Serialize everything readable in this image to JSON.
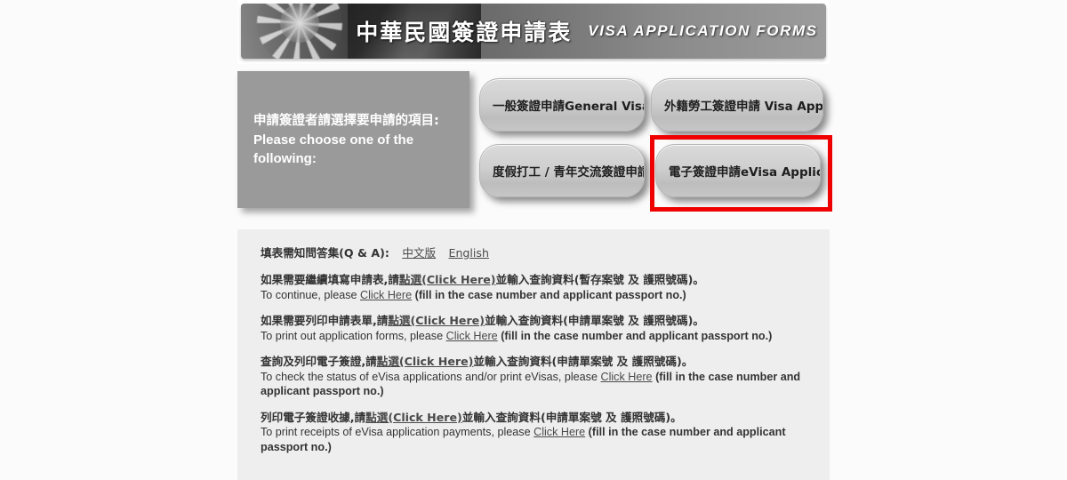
{
  "banner": {
    "title_cn": "中華民國簽證申請表",
    "title_en": "VISA APPLICATION FORMS",
    "art_name": "roc-flag-sun-emblem"
  },
  "chooser": {
    "prompt_cn": "申請簽證者請選擇要申請的項目:",
    "prompt_en_line1": "Please choose one of the",
    "prompt_en_line2": "following:",
    "buttons": [
      {
        "id": "general",
        "label": "一般簽證申請General Visa Ap"
      },
      {
        "id": "worker",
        "label": "外籍勞工簽證申請 Visa Applica"
      },
      {
        "id": "workhol",
        "label": "度假打工 / 青年交流簽證申請Wo"
      },
      {
        "id": "evisa",
        "label": "電子簽證申請eVisa Applicatio"
      }
    ],
    "highlight_color": "#ee0000",
    "highlighted_button": "evisa"
  },
  "instructions": {
    "qa_label": "填表需知問答集(Q & A):",
    "qa_link_cn": "中文版",
    "qa_link_en": "English",
    "paragraphs": [
      {
        "cn_before": "如果需要繼續填寫申請表,請",
        "cn_link": "點選(Click Here)",
        "cn_after": "並輸入查詢資料(暫存案號 及 護照號碼)。",
        "en_before": "To continue, please ",
        "en_link": "Click Here",
        "en_after": " (fill in the case number and applicant passport no.)"
      },
      {
        "cn_before": "如果需要列印申請表單,請",
        "cn_link": "點選(Click Here)",
        "cn_after": "並輸入查詢資料(申請單案號 及 護照號碼)。",
        "en_before": "To print out application forms, please ",
        "en_link": "Click Here",
        "en_after": " (fill in the case number and applicant passport no.)"
      },
      {
        "cn_before": "查詢及列印電子簽證,請",
        "cn_link": "點選(Click Here)",
        "cn_after": "並輸入查詢資料(申請單案號 及 護照號碼)。",
        "en_before": "To check the status of eVisa applications and/or print eVisas, please ",
        "en_link": "Click Here",
        "en_after": " (fill in the case number and applicant passport no.)"
      },
      {
        "cn_before": "列印電子簽證收據,請",
        "cn_link": "點選(Click Here)",
        "cn_after": "並輸入查詢資料(申請單案號 及 護照號碼)。",
        "en_before": "To print receipts of eVisa application payments, please ",
        "en_link": "Click Here",
        "en_after": " (fill in the case number and applicant passport no.)"
      }
    ]
  },
  "colors": {
    "page_bg": "#fbfbfb",
    "panel_gray": "#9a9a9a",
    "content_bg": "#eeeeee",
    "button_face": "#cfcfcf",
    "highlight_red": "#ee0000"
  }
}
